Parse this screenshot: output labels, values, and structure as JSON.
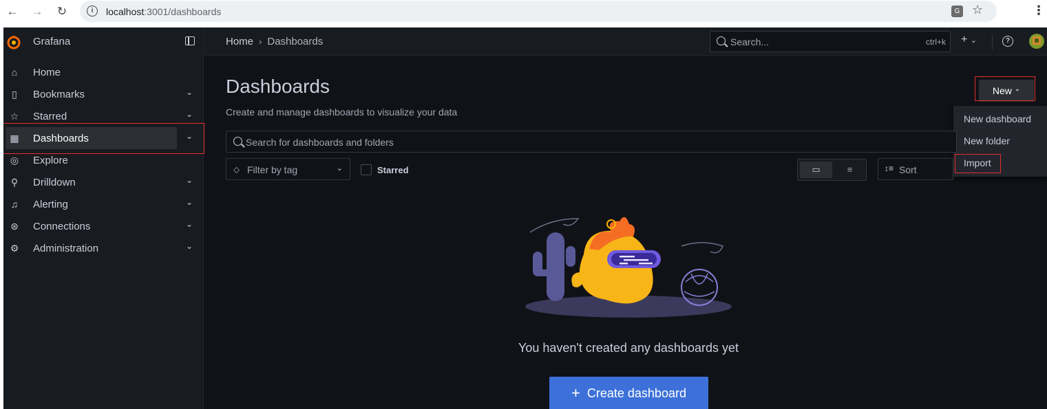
{
  "browser": {
    "url_host": "localhost",
    "url_path": ":3001/dashboards"
  },
  "app": {
    "brand": "Grafana"
  },
  "sidebar": {
    "items": [
      {
        "label": "Home",
        "icon": "home-icon"
      },
      {
        "label": "Bookmarks",
        "icon": "bookmark-icon"
      },
      {
        "label": "Starred",
        "icon": "star-icon"
      },
      {
        "label": "Dashboards",
        "icon": "apps-icon"
      },
      {
        "label": "Explore",
        "icon": "compass-icon"
      },
      {
        "label": "Drilldown",
        "icon": "drilldown-icon"
      },
      {
        "label": "Alerting",
        "icon": "bell-icon"
      },
      {
        "label": "Connections",
        "icon": "connections-icon"
      },
      {
        "label": "Administration",
        "icon": "gear-icon"
      }
    ]
  },
  "breadcrumb": {
    "home": "Home",
    "current": "Dashboards"
  },
  "topsearch": {
    "placeholder": "Search...",
    "shortcut": "ctrl+k"
  },
  "page": {
    "title": "Dashboards",
    "subtitle": "Create and manage dashboards to visualize your data"
  },
  "new_button": {
    "label": "New"
  },
  "new_menu": {
    "items": [
      "New dashboard",
      "New folder",
      "Import"
    ]
  },
  "filters": {
    "search_placeholder": "Search for dashboards and folders",
    "tag_placeholder": "Filter by tag",
    "starred_label": "Starred",
    "sort_label": "Sort"
  },
  "empty_state": {
    "message": "You haven't created any dashboards yet",
    "cta": "Create dashboard"
  },
  "colors": {
    "background": "#111217",
    "panel": "#181b1f",
    "primary": "#3d71d9",
    "highlight": "#e02f2f"
  }
}
